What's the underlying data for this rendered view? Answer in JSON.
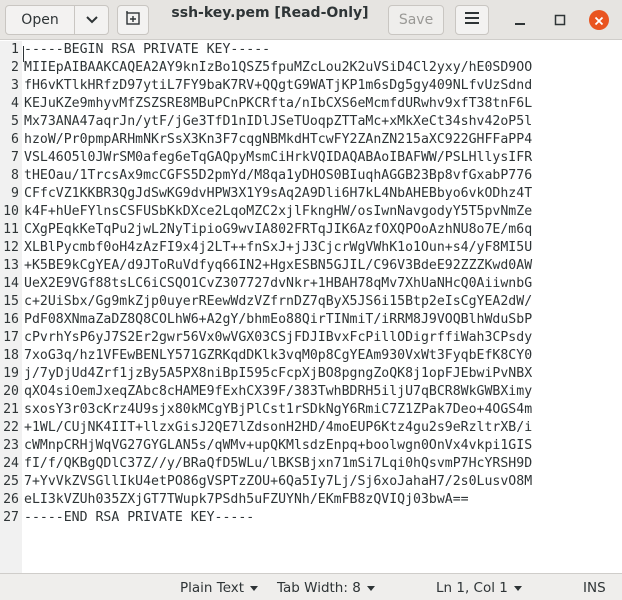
{
  "header": {
    "open_label": "Open",
    "title": "ssh-key.pem [Read-Only]",
    "save_label": "Save"
  },
  "colors": {
    "headerbar_bg": "#e6e4e1",
    "close_button": "#e95420",
    "gutter_bg": "#f1f1f1",
    "text": "#2e3436"
  },
  "icons": {
    "open_dropdown": "chevron-down-icon",
    "new_tab": "new-tab-icon",
    "menu": "hamburger-menu-icon",
    "minimize": "minimize-icon",
    "maximize": "maximize-icon",
    "close": "close-icon"
  },
  "editor": {
    "lines": [
      {
        "num": "1",
        "text": "-----BEGIN RSA PRIVATE KEY-----"
      },
      {
        "num": "2",
        "text": "MIIEpAIBAAKCAQEA2AY9knIzBo1QSZ5fpuMZcLou2K2uVSiD4Cl2yxy/hE0SD9OO"
      },
      {
        "num": "3",
        "text": "fH6vKTlkHRfzD97ytiL7FY9baK7RV+QQgtG9WATjKP1m6sDg5gy409NLfvUzSdnd"
      },
      {
        "num": "4",
        "text": "KEJuKZe9mhyvMfZSZSRE8MBuPCnPKCRfta/nIbCXS6eMcmfdURwhv9xfT38tnF6L"
      },
      {
        "num": "5",
        "text": "Mx73ANA47aqrJn/ytF/jGe3TfD1nIDlJSeTUoqpZTTaMc+xMkXeCt34shv42oP5l"
      },
      {
        "num": "6",
        "text": "hzoW/Pr0pmpARHmNKrSsX3Kn3F7cqgNBMkdHTcwFY2ZAnZN215aXC922GHFFaPP4"
      },
      {
        "num": "7",
        "text": "VSL46O5l0JWrSM0afeg6eTqGAQpyMsmCiHrkVQIDAQABAoIBAFWW/PSLHllysIFR"
      },
      {
        "num": "8",
        "text": "tHEOau/1TrcsAx9mcCGFS5D2pmYd/M8qa1yDHOS0BIuqhAGGB23Bp8vfGxabP776"
      },
      {
        "num": "9",
        "text": "CFfcVZ1KKBR3QgJdSwKG9dvHPW3X1Y9sAq2A9Dli6H7kL4NbAHEBbyo6vkODhz4T"
      },
      {
        "num": "10",
        "text": "k4F+hUeFYlnsCSFUSbKkDXce2LqoMZC2xjlFkngHW/osIwnNavgodyY5T5pvNmZe"
      },
      {
        "num": "11",
        "text": "CXgPEqkKeTqPu2jwL2NyTipioG9wvIA802FRTqJIK6AzfOXQPOoAzhNU8o7E/m6q"
      },
      {
        "num": "12",
        "text": "XLBlPycmbf0oH4zAzFI9x4j2LT++fnSxJ+jJ3CjcrWgVWhK1o1Oun+s4/yF8MI5U"
      },
      {
        "num": "13",
        "text": "+K5BE9kCgYEA/d9JToRuVdfyq66IN2+HgxESBN5GJIL/C96V3BdeE92ZZZKwd0AW"
      },
      {
        "num": "14",
        "text": "UeX2E9VGf88tsLC6iCSQO1CvZ307727dvNkr+1HBAH78qMv7XhUaNHcQ0AiiwnbG"
      },
      {
        "num": "15",
        "text": "c+2UiSbx/Gg9mkZjp0uyerREewWdzVZfrnDZ7qByX5JS6i15Btp2eIsCgYEA2dW/"
      },
      {
        "num": "16",
        "text": "PdF08XNmaZaDZ8Q8COLhW6+A2gY/bhmEo88QirTINmiT/iRRM8J9VOQBlhWduSbP"
      },
      {
        "num": "17",
        "text": "cPvrhYsP6yJ7S2Er2gwr56Vx0wVGX03CSjFDJIBvxFcPillODigrffiWah3CPsdy"
      },
      {
        "num": "18",
        "text": "7xoG3q/hz1VFEwBENLY571GZRKqdDKlk3vqM0p8CgYEAm930VxWt3FyqbEfK8CY0"
      },
      {
        "num": "19",
        "text": "j/7yDjUd4Zrf1jzBy5A5PX8niBpI595cFcpXjBO8pgngZoQK8j1opFJEbwiPvNBX"
      },
      {
        "num": "20",
        "text": "qXO4siOemJxeqZAbc8cHAME9fExhCX39F/383TwhBDRH5iljU7qBCR8WkGWBXimy"
      },
      {
        "num": "21",
        "text": "sxosY3r03cKrz4U9sjx80kMCgYBjPlCst1rSDkNgY6RmiC7Z1ZPak7Deo+4OGS4m"
      },
      {
        "num": "22",
        "text": "+1WL/CUjNK4IIT+llzxGisJ2QE7lZdsonH2HD/4moEUP6Ktz4gu2s9eRzltrXB/i"
      },
      {
        "num": "23",
        "text": "cWMnpCRHjWqVG27GYGLAN5s/qWMv+upQKMlsdzEnpq+boolwgn0OnVx4vkpi1GIS"
      },
      {
        "num": "24",
        "text": "fI/f/QKBgQDlC37Z//y/BRaQfD5WLu/lBKSBjxn71mSi7Lqi0hQsvmP7HcYRSH9D"
      },
      {
        "num": "25",
        "text": "7+YvVkZVSGllIkU4etPO86gVSPTzZOU+6Qa5Iy7Lj/Sj6xoJahaH7/2s0LusvO8M"
      },
      {
        "num": "26",
        "text": "eLI3kVZUh035ZXjGT7TWupk7PSdh5uFZUYNh/EKmFB8zQVIQj03bwA=="
      },
      {
        "num": "27",
        "text": "-----END RSA PRIVATE KEY-----"
      }
    ]
  },
  "statusbar": {
    "language": "Plain Text",
    "tab_width": "Tab Width: 8",
    "position": "Ln 1, Col 1",
    "mode": "INS"
  }
}
